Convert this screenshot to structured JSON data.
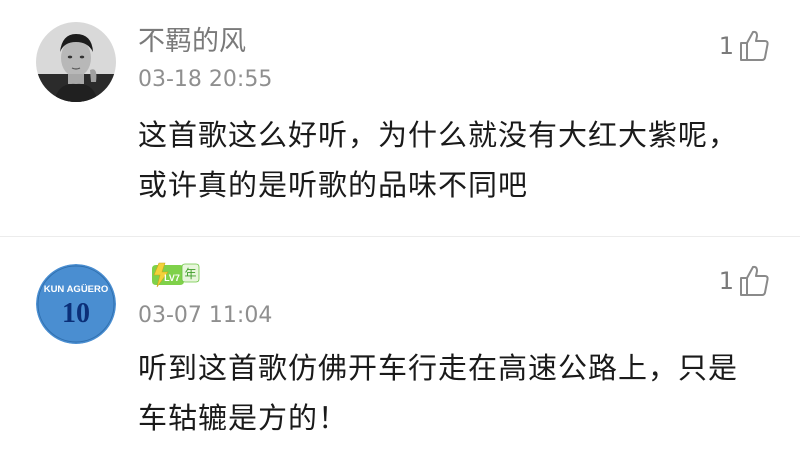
{
  "comments": [
    {
      "username": "不羁的风",
      "timestamp": "03-18 20:55",
      "likes": "1",
      "text_lines": [
        "这首歌这么好听，为什么就没有大红大紫呢，",
        "或许真的是听歌的品味不同吧"
      ],
      "avatar": "portrait-photo"
    },
    {
      "username": "",
      "badge": {
        "level": "LV7",
        "suffix": "年"
      },
      "timestamp": "03-07 11:04",
      "likes": "1",
      "text_lines": [
        "听到这首歌仿佛开车行走在高速公路上，只是",
        "车轱辘是方的！"
      ],
      "avatar": {
        "top": "KUN AGÜERO",
        "number": "10"
      }
    }
  ],
  "icons": {
    "like": "thumbs-up-icon"
  },
  "colors": {
    "muted": "#8f8f8f",
    "text": "#1a1a1a",
    "badge_green": "#6cc644",
    "badge_yellow": "#f3d23a",
    "avatar_blue": "#4a8ed1"
  }
}
